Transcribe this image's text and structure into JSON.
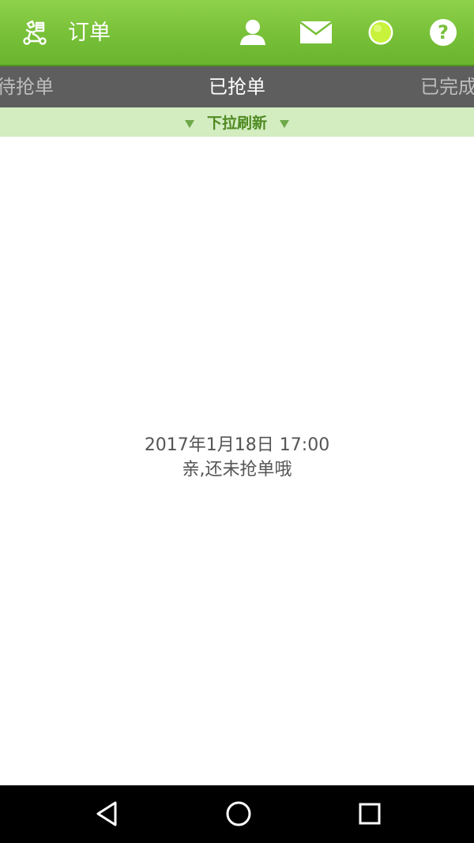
{
  "header": {
    "title": "订单",
    "logo_icon": "rider-logo-icon",
    "icons": [
      "user-icon",
      "mail-icon",
      "status-dot-icon",
      "help-icon"
    ],
    "status_color": "#c8f23c",
    "accent_color": "#7cc241"
  },
  "tabs": [
    {
      "label": "待抢单",
      "active": false
    },
    {
      "label": "已抢单",
      "active": true
    },
    {
      "label": "已完成",
      "active": false
    }
  ],
  "refresh": {
    "label": "下拉刷新"
  },
  "empty_state": {
    "timestamp": "2017年1月18日 17:00",
    "message": "亲,还未抢单哦"
  },
  "navbar": {
    "icons": [
      "back-icon",
      "home-icon",
      "recent-apps-icon"
    ]
  }
}
